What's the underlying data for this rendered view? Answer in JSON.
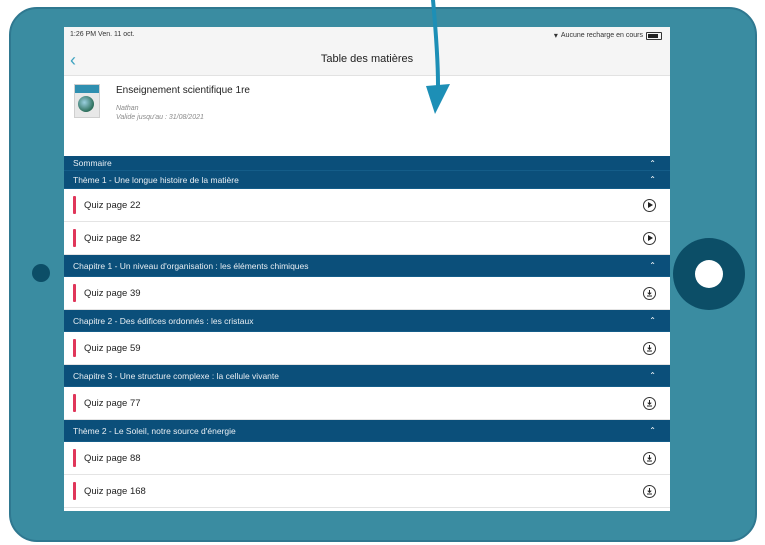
{
  "status": {
    "time": "1:26 PM",
    "date": "Ven. 11 oct.",
    "charge": "Aucune recharge en cours"
  },
  "nav": {
    "title": "Table des matières"
  },
  "book": {
    "title": "Enseignement scientifique 1re",
    "publisher": "Nathan",
    "validity": "Valide jusqu'au : 31/08/2021"
  },
  "toc": {
    "sommaire": "Sommaire",
    "sections": [
      {
        "title": "Thème 1 - Une longue histoire de la matière",
        "items": [
          {
            "label": "Quiz page 22",
            "action": "play-icon"
          },
          {
            "label": "Quiz page 82",
            "action": "play-icon"
          }
        ]
      },
      {
        "title": "Chapitre 1 - Un niveau d'organisation : les éléments chimiques",
        "items": [
          {
            "label": "Quiz page 39",
            "action": "download-icon"
          }
        ]
      },
      {
        "title": "Chapitre 2 - Des édifices ordonnés : les cristaux",
        "items": [
          {
            "label": "Quiz page 59",
            "action": "download-icon"
          }
        ]
      },
      {
        "title": "Chapitre 3 - Une structure complexe : la cellule vivante",
        "items": [
          {
            "label": "Quiz page 77",
            "action": "download-icon"
          }
        ]
      },
      {
        "title": "Thème 2 - Le Soleil, notre source d'énergie",
        "items": [
          {
            "label": "Quiz page 88",
            "action": "download-icon"
          },
          {
            "label": "Quiz page 168",
            "action": "download-icon"
          }
        ]
      }
    ]
  },
  "colors": {
    "tablet": "#3a8ca1",
    "header": "#0b4f7a",
    "accent_bar": "#e0365a",
    "arrow": "#1d8fb6"
  }
}
